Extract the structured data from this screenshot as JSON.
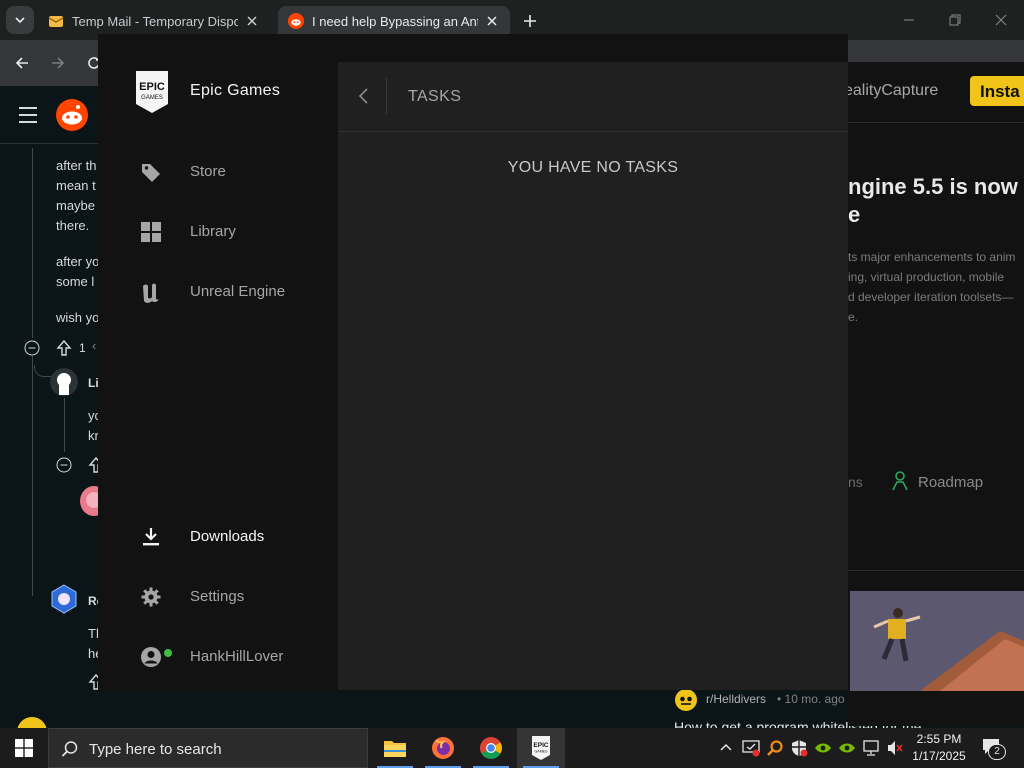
{
  "browser": {
    "tabs": [
      {
        "title": "Temp Mail - Temporary Disposable Email"
      },
      {
        "title": "I need help Bypassing an Anti-cheat"
      }
    ]
  },
  "reddit": {
    "comment_lines": [
      "after th",
      "mean t",
      "maybe",
      "there.",
      "after yo",
      "some l",
      "wish yo"
    ],
    "vote_count": "1",
    "user1_initial": "Li",
    "reply_lines": [
      "yo",
      "kr"
    ],
    "user2_initial": "Re",
    "reply2_lines": [
      "Th",
      "he"
    ],
    "bottom_subreddit": "r/Helldivers",
    "bottom_age": "• 10 mo. ago",
    "bottom_title": "How to get a program whitelisted for the"
  },
  "epic_web": {
    "nav_item": "ealityCapture",
    "install_button": "Insta",
    "headline_line1": "ngine 5.5 is now",
    "headline_line2": "e",
    "body_lines": [
      "ts major enhancements to anim",
      "ing, virtual production, mobile",
      "d developer iteration toolsets—",
      "e."
    ],
    "link_partial": "ns",
    "roadmap": "Roadmap"
  },
  "launcher": {
    "brand": "Epic Games",
    "nav": [
      {
        "label": "Store",
        "icon": "tag-icon"
      },
      {
        "label": "Library",
        "icon": "grid-icon"
      },
      {
        "label": "Unreal Engine",
        "icon": "unreal-icon"
      }
    ],
    "bottom_nav": [
      {
        "label": "Downloads",
        "icon": "download-icon"
      },
      {
        "label": "Settings",
        "icon": "gear-icon"
      },
      {
        "label": "HankHillLover",
        "icon": "user-icon"
      }
    ],
    "panel_title": "TASKS",
    "empty_message": "YOU HAVE NO TASKS"
  },
  "taskbar": {
    "search_placeholder": "Type here to search",
    "time": "2:55 PM",
    "date": "1/17/2025",
    "notification_count": "2"
  },
  "colors": {
    "accent_yellow": "#f0c419",
    "status_green": "#3fbf3f",
    "taskbar_active": "#5ea0ef"
  }
}
